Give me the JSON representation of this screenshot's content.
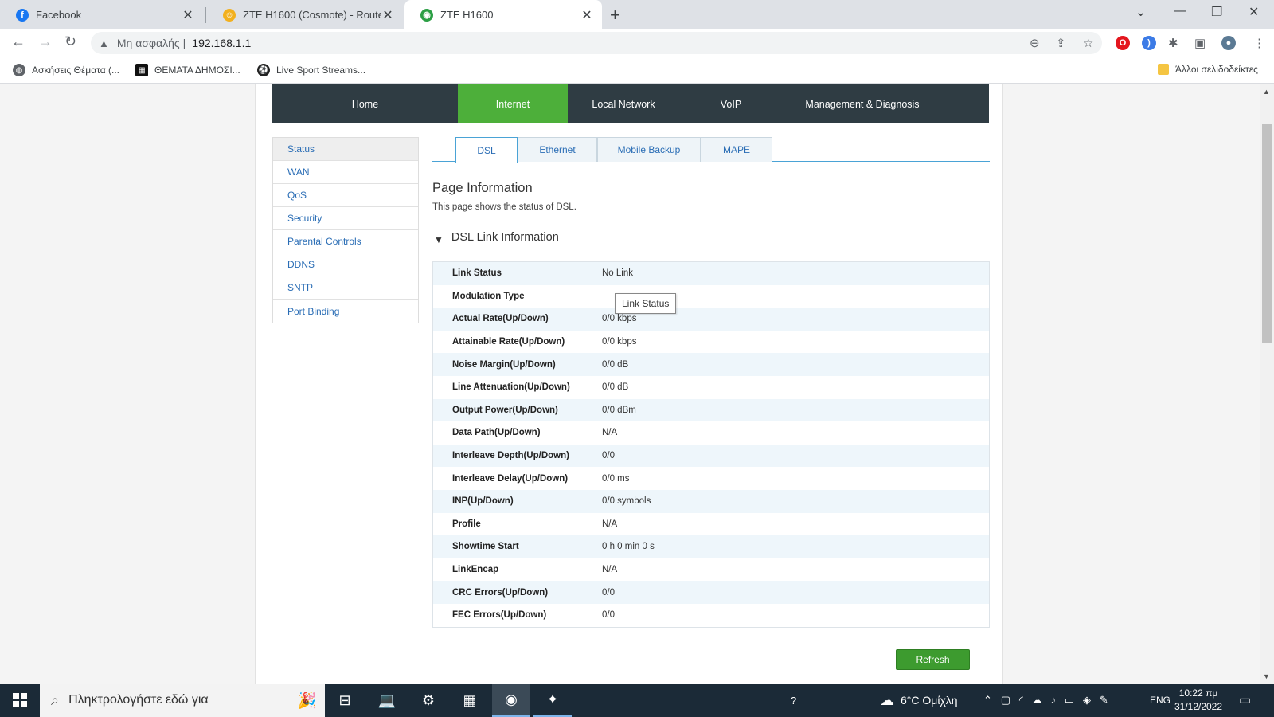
{
  "browser": {
    "tabs": [
      {
        "title": "Facebook",
        "favicon": "facebook-icon",
        "color": "#1877f2"
      },
      {
        "title": "ZTE H1600 (Cosmote) - Routers -",
        "favicon": "forum-icon",
        "color": "#f2b01e"
      },
      {
        "title": "ZTE H1600",
        "favicon": "router-icon",
        "color": "#2c9f45",
        "active": true
      }
    ],
    "address": {
      "insecure_label": "Μη ασφαλής",
      "url": "192.168.1.1"
    },
    "bookmarks": [
      {
        "label": "Ασκήσεις Θέματα (...",
        "icon": "globe-icon"
      },
      {
        "label": "ΘΕΜΑΤΑ ΔΗΜΟΣΙ...",
        "icon": "site-icon"
      },
      {
        "label": "Live Sport Streams...",
        "icon": "soccer-ball-icon"
      }
    ],
    "other_bookmarks": "Άλλοι σελιδοδείκτες"
  },
  "router": {
    "topnav": [
      "Home",
      "Internet",
      "Local Network",
      "VoIP",
      "Management & Diagnosis"
    ],
    "active_topnav": "Internet",
    "leftmenu": [
      "Status",
      "WAN",
      "QoS",
      "Security",
      "Parental Controls",
      "DDNS",
      "SNTP",
      "Port Binding"
    ],
    "subtabs": [
      "DSL",
      "Ethernet",
      "Mobile Backup",
      "MAPE"
    ],
    "page_info": {
      "title": "Page Information",
      "desc": "This page shows the status of DSL."
    },
    "section_title": "DSL Link Information",
    "rows": [
      {
        "key": "Link Status",
        "value": "No Link"
      },
      {
        "key": "Modulation Type",
        "value": ""
      },
      {
        "key": "Actual Rate(Up/Down)",
        "value": "0/0 kbps"
      },
      {
        "key": "Attainable Rate(Up/Down)",
        "value": "0/0 kbps"
      },
      {
        "key": "Noise Margin(Up/Down)",
        "value": "0/0 dB"
      },
      {
        "key": "Line Attenuation(Up/Down)",
        "value": "0/0 dB"
      },
      {
        "key": "Output Power(Up/Down)",
        "value": "0/0 dBm"
      },
      {
        "key": "Data Path(Up/Down)",
        "value": "N/A"
      },
      {
        "key": "Interleave Depth(Up/Down)",
        "value": "0/0"
      },
      {
        "key": "Interleave Delay(Up/Down)",
        "value": "0/0 ms"
      },
      {
        "key": "INP(Up/Down)",
        "value": "0/0 symbols"
      },
      {
        "key": "Profile",
        "value": "N/A"
      },
      {
        "key": "Showtime Start",
        "value": "0 h 0 min 0 s"
      },
      {
        "key": "LinkEncap",
        "value": "N/A"
      },
      {
        "key": "CRC Errors(Up/Down)",
        "value": "0/0"
      },
      {
        "key": "FEC Errors(Up/Down)",
        "value": "0/0"
      }
    ],
    "tooltip": "Link Status",
    "refresh_label": "Refresh",
    "colors": {
      "nav_bg": "#2f3c43",
      "accent_green": "#4daf3a",
      "link_blue": "#2a6db5"
    }
  },
  "taskbar": {
    "search_placeholder": "Πληκτρολογήστε εδώ για",
    "weather": "6°C  Ομίχλη",
    "lang": "ENG",
    "time": "10:22 πμ",
    "date": "31/12/2022"
  }
}
